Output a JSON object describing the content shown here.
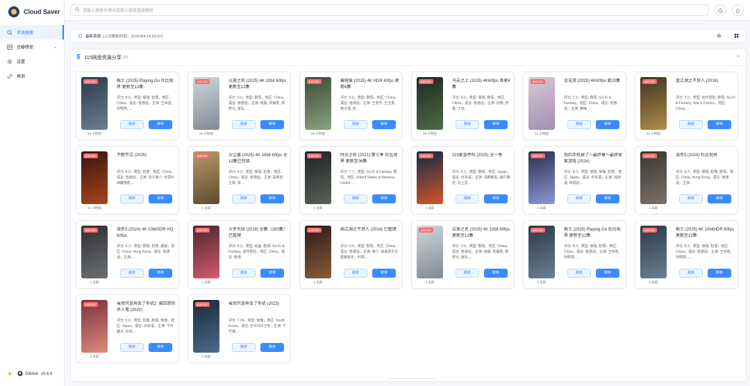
{
  "app": {
    "name": "Cloud Saver",
    "version": "v0.4.4",
    "github_label": "GitHub"
  },
  "sidebar": {
    "items": [
      {
        "label": "资源搜索",
        "icon": "search-icon",
        "active": true
      },
      {
        "label": "豆瓣榜单",
        "icon": "list-icon",
        "has_arrow": true
      },
      {
        "label": "设置",
        "icon": "gear-icon"
      },
      {
        "label": "再测",
        "icon": "link-icon"
      }
    ]
  },
  "search": {
    "placeholder": "请输入搜索关键词或输入链接直接解析"
  },
  "status": {
    "label": "最新资源",
    "time_text": "(上次刷新时间：2025/4/4 16:53:07)"
  },
  "panel": {
    "title": "115网盘资源分享",
    "count": "(20)"
  },
  "buttons": {
    "jump": "跳转",
    "save": "转存"
  },
  "colors": {
    "accent": "#3a7bff",
    "badge": "#f56c6c"
  },
  "cards": [
    {
      "badge": "pan115",
      "title": "枫士 (2025) Playing.Go 杜比视界 更新至13集",
      "desc": "评分: 8.5，类型: 悬疑, 犯罪，地区: China，语言: 普通话，主演: 王世强, 孙明亮, ...",
      "time": "18 小时前"
    },
    {
      "badge": "pan115",
      "title": "以美之名 (2025) 4K 10bit 60fps 更新至12集",
      "desc": "评分: 0.0，类型: 剧情，地区: China，语言: 普通话，主演: 晓晨, 贾静雯, 侯梦元, 宫弘, ...",
      "time": "20 小时前"
    },
    {
      "badge": "pan115",
      "title": "偏得爱 (2025) 4K HDR 60fps 更新6集",
      "desc": "评分: 8.0，类型: 剧情，地区: China，语言: 普通话，主演: 王安宇, 王玉雯, 黄子琪, 赵...",
      "time": "20 小时前"
    },
    {
      "badge": "pan115",
      "title": "乌云之上 (2025) 4K60fps 首更4集",
      "desc": "评分: 0.0，类型: 悬疑, 剧情，地区: China，语言: 普通话，主演: 孙艳, 罗晋, 丁迈...",
      "time": "20 小时前"
    },
    {
      "badge": "pan115",
      "title": "念无双 (2025) 4K60fps 更20集",
      "desc": "评分: 7.2，类型: 剧情, Sci-Fi & Fantasy，地区: China，语言: 普通话，主演: 庚梅, ...",
      "time": "21 小时前"
    },
    {
      "badge": "pan115",
      "title": "蓝江湖之不良人 (2016)",
      "desc": "评分: 6.0，类型: 动作冒险, 剧情, Sci-Fi & Fantasy, War & Politics，地区: China, ...",
      "time": "21 小时前"
    },
    {
      "badge": "pan115",
      "title": "不眠不立 (2025)",
      "desc": "评分: 4.5，类型: 犯罪，地区: China，语言: 普通话，主演: 饺子简介: 纪录片西藏电影...",
      "time": "21 小时前"
    },
    {
      "badge": "pan115",
      "title": "沙尘暴 (2025) 4K 10bit 60fps 全12集已完结",
      "desc": "评分: 8.0，类型: 悬疑, 犯罪，地区: China，语言: 普通话，主演: 段奕宏, 王菲, 张...",
      "time": "1 天前"
    },
    {
      "badge": "pan115",
      "title": "时光之轮 (2021) 第三季 杜比视界 更新至06集",
      "desc": "评分: 7.7，类型: Sci-Fi & Fantasy, 剧情，地区: United States of America, United ...",
      "time": "1 天前"
    },
    {
      "badge": "pan115",
      "title": "119紧急呼叫 (2025) 全一季",
      "desc": "评分: 6.2，类型: 剧情，地区: Japan，语言: 日本语，主演: 清野菜名, 濑户康史, 见上爱...",
      "time": "1 天前"
    },
    {
      "badge": "pan115",
      "title": "我的手机掉了～最终章～最终罪客游戏 (2024)",
      "desc": "评分: 8.0，类型: 悬疑, 惊悚, 犯罪，地区: Japan，语言: 日本语，主演: 成田凌, 权恩妃...",
      "time": "1 天前"
    },
    {
      "badge": "pan115",
      "title": "误杀3 (2024) 杜比视界",
      "desc": "评分: 6.2，类型: 悬疑, 犯罪, 剧情，地区: China, Hong Kong，语言: 普通话，主演...",
      "time": "1 天前"
    },
    {
      "badge": "pan115",
      "title": "误杀3 (2024) 4K 10bitSDR HQ 60fps",
      "desc": "评分: 6.2，类型: 剧情, 犯罪, 悬疑，地区: China, Hong Kong，语言: 普通话，主演...",
      "time": "1 天前"
    },
    {
      "badge": "pan115",
      "title": "斗罗大陆 (2018) 全集（263集）已整理",
      "desc": "评分: 8.3，类型: 动画, 剧情, Sci-Fi & Fantasy, 动作冒险，地区: China，语言: 普通...",
      "time": "1 天前"
    },
    {
      "badge": "pan115",
      "title": "画江湖之不良人 (2014) 已整理",
      "desc": "评分: 0.0，类型: 剧情，地区: China，语言: 普通话，主演: 简介: 故事发生在唐朝末年，时局...",
      "time": "1 天前"
    },
    {
      "badge": "pan115",
      "title": "以美之名 (2025) 4K 10bit 60fps 更新至12集",
      "desc": "评分: 0.0，类型: 剧情，地区: China，语言: 普通话，主演: 晓晨, 贾静雯, 侯梦元, 宫弘, ...",
      "time": "2 天前"
    },
    {
      "badge": "pan115",
      "title": "枫士 (2025) Playing.Go 杜比视界 更新至12集",
      "desc": "评分: 8.2，类型: 悬疑, 犯罪，地区: China，语言: 普通话，主演: 王世强, 孙明亮, ...",
      "time": "2 天前"
    },
    {
      "badge": "pan115",
      "title": "枫士 (2025) 4K 10bitHDR 60fps 更新至12集",
      "desc": "评分: 8.2，类型: 悬疑, 犯罪，地区: China，语言: 普通话，主演: 王世强, 孙明亮, ...",
      "time": "2 天前"
    },
    {
      "badge": "pan115",
      "title": "虽然只是弄丢了手机2: 被囚禁的杀人鬼 (2020)",
      "desc": "评分: 5.0，类型: 犯罪, 剧情, 惊悚，地区: Japan，语言: 日本语，主演: 千叶雄大, 白石...",
      "time": "2 天前"
    },
    {
      "badge": "pan115",
      "title": "虽然只是弄丢了手机 (2023)",
      "desc": "评分: 7.34，类型: 惊悚，地区: South Korea，语言: 한국어/조선말，主演: 千玗瑞, ...",
      "time": "2 天前"
    }
  ]
}
